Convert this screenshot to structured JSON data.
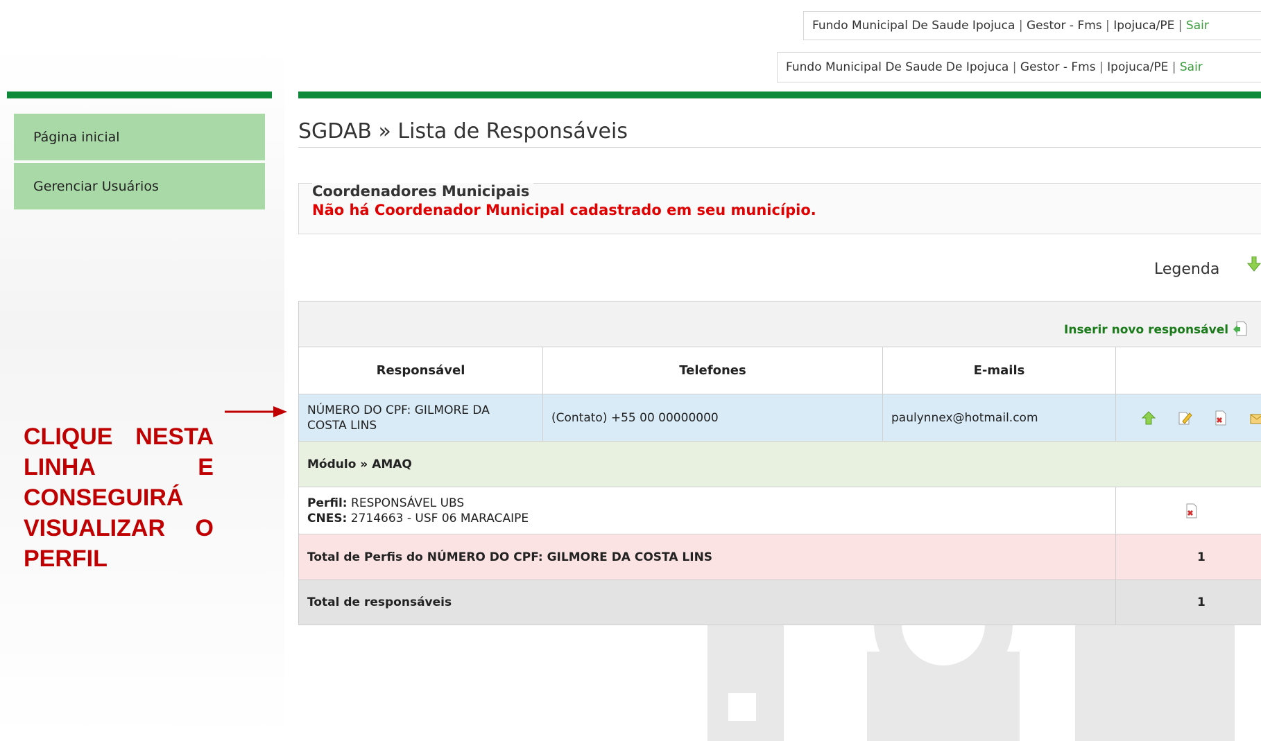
{
  "header": {
    "line1": {
      "org": "Fundo Municipal De Saude Ipojuca",
      "role": "Gestor - Fms",
      "city": "Ipojuca/PE",
      "logout": "Sair",
      "sep": "|"
    },
    "line2": {
      "org": "Fundo Municipal De Saude De Ipojuca",
      "role": "Gestor - Fms",
      "city": "Ipojuca/PE",
      "logout": "Sair",
      "sep": "|"
    }
  },
  "sidebar": {
    "items": [
      {
        "label": "Página inicial"
      },
      {
        "label": "Gerenciar Usuários"
      }
    ]
  },
  "main": {
    "title": "SGDAB » Lista de Responsáveis",
    "coordenadores": {
      "legend": "Coordenadores Municipais",
      "message": "Não há Coordenador Municipal cadastrado em seu município."
    },
    "legenda_label": "Legenda",
    "insert_label": "Inserir novo responsável",
    "table": {
      "headers": [
        "Responsável",
        "Telefones",
        "E-mails",
        ""
      ],
      "responsavel_row": {
        "name": "NÚMERO DO CPF: GILMORE DA COSTA LINS",
        "phone": "(Contato) +55 00 00000000",
        "email": "paulynnex@hotmail.com"
      },
      "modulo": "Módulo » AMAQ",
      "perfil": {
        "perfil_label": "Perfil:",
        "perfil_value": "RESPONSÁVEL UBS",
        "cnes_label": "CNES:",
        "cnes_value": "2714663 - USF 06 MARACAIPE"
      },
      "total_perfis": {
        "label": "Total de Perfis do NÚMERO DO CPF: GILMORE DA COSTA LINS",
        "value": "1"
      },
      "total_responsaveis": {
        "label": "Total de responsáveis",
        "value": "1"
      }
    }
  },
  "annotation": {
    "text": "CLIQUE NESTA LINHA E CONSEGUIRÁ VISUALIZAR O PERFIL",
    "color": "#c00000"
  },
  "icons": {
    "legenda": "green-down-arrow-icon",
    "insert": "add-document-icon",
    "row_actions": [
      "promote-icon",
      "edit-icon",
      "delete-document-icon",
      "email-icon"
    ],
    "perfil_action": "delete-document-icon"
  },
  "colors": {
    "brand_green": "#0e8a3a",
    "sidebar_item": "#a9d9a6",
    "error_red": "#e00000",
    "selected_row": "#d9ebf7",
    "modulo_row": "#e8f0e0",
    "total_row": "#fbe3e3",
    "summary_row": "#e3e3e3"
  }
}
